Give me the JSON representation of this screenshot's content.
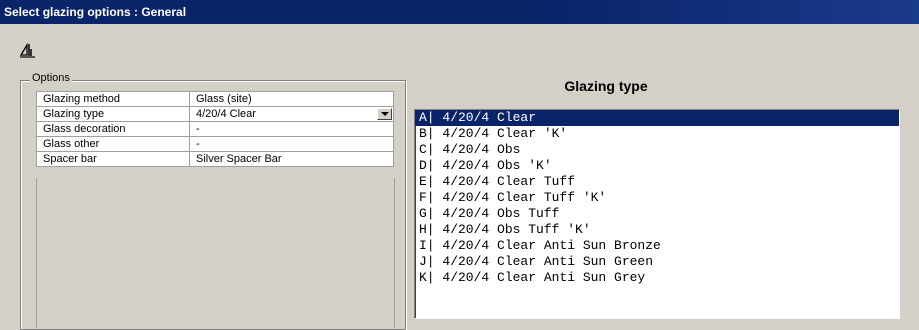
{
  "window": {
    "title": "Select glazing options : General"
  },
  "toolbar": {
    "icon": "properties-icon"
  },
  "options": {
    "group_label": "Options",
    "rows": [
      {
        "label": "Glazing method",
        "value": "Glass (site)"
      },
      {
        "label": "Glazing type",
        "value": "4/20/4 Clear"
      },
      {
        "label": "Glass decoration",
        "value": "-"
      },
      {
        "label": "Glass other",
        "value": "-"
      },
      {
        "label": "Spacer bar",
        "value": "Silver Spacer Bar"
      }
    ]
  },
  "glazing_list": {
    "title": "Glazing type",
    "selected_index": 0,
    "items": [
      "A| 4/20/4 Clear",
      "B| 4/20/4 Clear 'K'",
      "C| 4/20/4 Obs",
      "D| 4/20/4 Obs 'K'",
      "E| 4/20/4 Clear Tuff",
      "F| 4/20/4 Clear Tuff 'K'",
      "G| 4/20/4 Obs Tuff",
      "H| 4/20/4 Obs Tuff 'K'",
      "I| 4/20/4 Clear Anti Sun Bronze",
      "J| 4/20/4 Clear Anti Sun Green",
      "K| 4/20/4 Clear Anti Sun Grey"
    ]
  },
  "colors": {
    "title_bar": "#0a246a",
    "selection": "#0a246a",
    "face": "#d4d0c8"
  }
}
